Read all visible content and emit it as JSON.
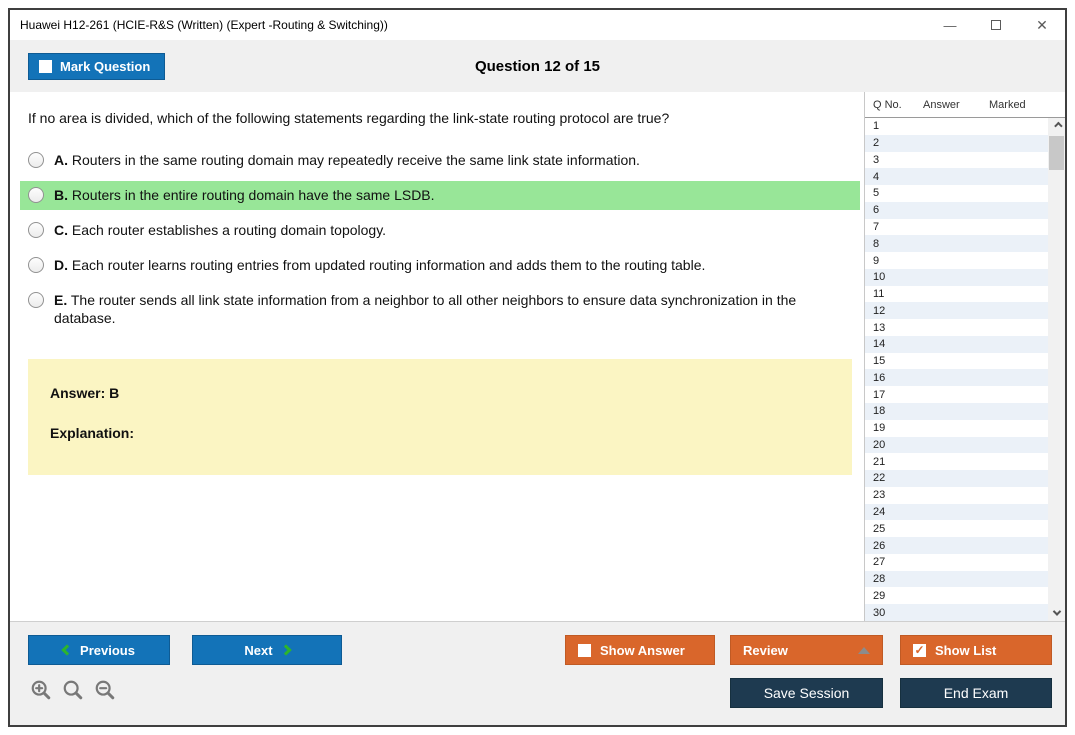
{
  "window": {
    "title": "Huawei H12-261 (HCIE-R&S (Written) (Expert -Routing & Switching))"
  },
  "icons": {
    "minimize": "—",
    "close": "✕",
    "checkbox_checked": "✓"
  },
  "toolbar": {
    "mark_question_label": "Mark Question",
    "question_counter": "Question 12 of 15"
  },
  "question": {
    "text": "If no area is divided, which of the following statements regarding the link-state routing protocol are true?",
    "options": [
      {
        "letter": "A.",
        "text": "Routers in the same routing domain may repeatedly receive the same link state information.",
        "state": ""
      },
      {
        "letter": "B.",
        "text": "Routers in the entire routing domain have the same LSDB.",
        "state": "highlighted"
      },
      {
        "letter": "C.",
        "text": "Each router establishes a routing domain topology.",
        "state": ""
      },
      {
        "letter": "D.",
        "text": "Each router learns routing entries from updated routing information and adds them to the routing table.",
        "state": ""
      },
      {
        "letter": "E.",
        "text": "The router sends all link state information from a neighbor to all other neighbors to ensure data synchronization in the database.",
        "state": ""
      }
    ],
    "answer_label": "Answer: B",
    "explanation_label": "Explanation:"
  },
  "sidebar": {
    "headers": {
      "q": "Q No.",
      "answer": "Answer",
      "marked": "Marked"
    },
    "rows": [
      {
        "q": "1",
        "answer": "",
        "marked": ""
      },
      {
        "q": "2",
        "answer": "",
        "marked": ""
      },
      {
        "q": "3",
        "answer": "",
        "marked": ""
      },
      {
        "q": "4",
        "answer": "",
        "marked": ""
      },
      {
        "q": "5",
        "answer": "",
        "marked": ""
      },
      {
        "q": "6",
        "answer": "",
        "marked": ""
      },
      {
        "q": "7",
        "answer": "",
        "marked": ""
      },
      {
        "q": "8",
        "answer": "",
        "marked": ""
      },
      {
        "q": "9",
        "answer": "",
        "marked": ""
      },
      {
        "q": "10",
        "answer": "",
        "marked": ""
      },
      {
        "q": "11",
        "answer": "",
        "marked": ""
      },
      {
        "q": "12",
        "answer": "",
        "marked": ""
      },
      {
        "q": "13",
        "answer": "",
        "marked": ""
      },
      {
        "q": "14",
        "answer": "",
        "marked": ""
      },
      {
        "q": "15",
        "answer": "",
        "marked": ""
      },
      {
        "q": "16",
        "answer": "",
        "marked": ""
      },
      {
        "q": "17",
        "answer": "",
        "marked": ""
      },
      {
        "q": "18",
        "answer": "",
        "marked": ""
      },
      {
        "q": "19",
        "answer": "",
        "marked": ""
      },
      {
        "q": "20",
        "answer": "",
        "marked": ""
      },
      {
        "q": "21",
        "answer": "",
        "marked": ""
      },
      {
        "q": "22",
        "answer": "",
        "marked": ""
      },
      {
        "q": "23",
        "answer": "",
        "marked": ""
      },
      {
        "q": "24",
        "answer": "",
        "marked": ""
      },
      {
        "q": "25",
        "answer": "",
        "marked": ""
      },
      {
        "q": "26",
        "answer": "",
        "marked": ""
      },
      {
        "q": "27",
        "answer": "",
        "marked": ""
      },
      {
        "q": "28",
        "answer": "",
        "marked": ""
      },
      {
        "q": "29",
        "answer": "",
        "marked": ""
      },
      {
        "q": "30",
        "answer": "",
        "marked": ""
      }
    ]
  },
  "footer": {
    "previous_label": "Previous",
    "next_label": "Next",
    "show_answer_label": "Show Answer",
    "review_label": "Review",
    "show_list_label": "Show List",
    "save_session_label": "Save Session",
    "end_exam_label": "End Exam"
  },
  "colors": {
    "accent_blue": "#1373b8",
    "accent_orange": "#d9662b",
    "navy": "#1e3a50",
    "highlight_green": "#98e698",
    "answer_yellow": "#fbf5c3",
    "row_alt_blue": "#ebf1f8"
  }
}
